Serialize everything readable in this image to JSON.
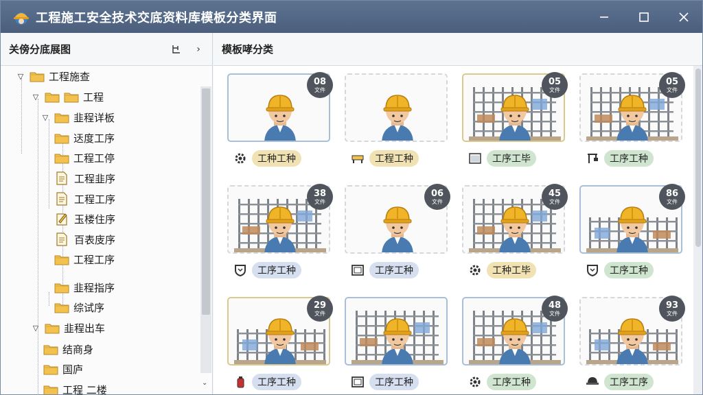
{
  "window": {
    "title": "工程施工安全技术交底资料库模板分类界面"
  },
  "left_panel": {
    "title": "关傍分底展图",
    "tree": [
      {
        "label": "工程施查",
        "type": "folder",
        "expanded": true
      },
      {
        "label": "工程",
        "type": "folder",
        "expanded": true
      },
      {
        "label": "韭程详板",
        "type": "folder",
        "expanded": true
      },
      {
        "label": "迗度工序",
        "type": "folder"
      },
      {
        "label": "工程工停",
        "type": "folder"
      },
      {
        "label": "工程韭序",
        "type": "doc"
      },
      {
        "label": "工程工序",
        "type": "doc"
      },
      {
        "label": "玉楼住序",
        "type": "doc-edit"
      },
      {
        "label": "百表庋序",
        "type": "doc"
      },
      {
        "label": "工程工序",
        "type": "folder"
      },
      {
        "label": "韭程指序",
        "type": "folder"
      },
      {
        "label": "综试序",
        "type": "folder"
      },
      {
        "label": "韭程出车",
        "type": "folder",
        "expanded": true
      },
      {
        "label": "结商身",
        "type": "folder"
      },
      {
        "label": "国庐",
        "type": "folder"
      },
      {
        "label": "工程 二楼",
        "type": "folder"
      }
    ]
  },
  "right_panel": {
    "title": "模板哮分类",
    "badge_unit_default": "文件",
    "cards": [
      {
        "count": "08",
        "unit": "文件",
        "tag": "工种工种",
        "tag_color": "y",
        "icon": "gear-icon",
        "scene": "plain",
        "frame": "solid-blue"
      },
      {
        "count": "",
        "unit": "",
        "tag": "工程工种",
        "tag_color": "y",
        "icon": "bench-icon",
        "scene": "plain",
        "frame": "dashed"
      },
      {
        "count": "05",
        "unit": "文件",
        "tag": "工序工毕",
        "tag_color": "g",
        "icon": "window-icon",
        "scene": "site",
        "frame": "solid-yellow"
      },
      {
        "count": "05",
        "unit": "文件",
        "tag": "工序工种",
        "tag_color": "g",
        "icon": "crane-icon",
        "scene": "site",
        "frame": "dashed"
      },
      {
        "count": "38",
        "unit": "文件",
        "tag": "工序工种",
        "tag_color": "b",
        "icon": "shield-icon",
        "scene": "site",
        "frame": "dashed"
      },
      {
        "count": "06",
        "unit": "文件",
        "tag": "工序工种",
        "tag_color": "b",
        "icon": "frame-icon",
        "scene": "plain",
        "frame": "dashed"
      },
      {
        "count": "45",
        "unit": "文件",
        "tag": "工种工毕",
        "tag_color": "y",
        "icon": "gear-icon",
        "scene": "site",
        "frame": "dashed"
      },
      {
        "count": "86",
        "unit": "文件",
        "tag": "工序工种",
        "tag_color": "g",
        "icon": "shield-icon",
        "scene": "site-wide",
        "frame": "solid-blue"
      },
      {
        "count": "29",
        "unit": "文件",
        "tag": "工序工种",
        "tag_color": "b",
        "icon": "extinguisher-icon",
        "scene": "site-wide",
        "frame": "solid-yellow"
      },
      {
        "count": "",
        "unit": "",
        "tag": "工序工种",
        "tag_color": "b",
        "icon": "frame-icon",
        "scene": "site",
        "frame": "solid-blue"
      },
      {
        "count": "48",
        "unit": "文件",
        "tag": "工序工种",
        "tag_color": "g",
        "icon": "gear-icon",
        "scene": "site",
        "frame": "solid-blue"
      },
      {
        "count": "93",
        "unit": "文件",
        "tag": "工序工序",
        "tag_color": "g",
        "icon": "helmet-icon",
        "scene": "site-wide",
        "frame": "dashed"
      }
    ]
  },
  "colors": {
    "titlebar": "#4b5f7d",
    "helmet": "#f0b429",
    "folder": "#f2c14e"
  }
}
